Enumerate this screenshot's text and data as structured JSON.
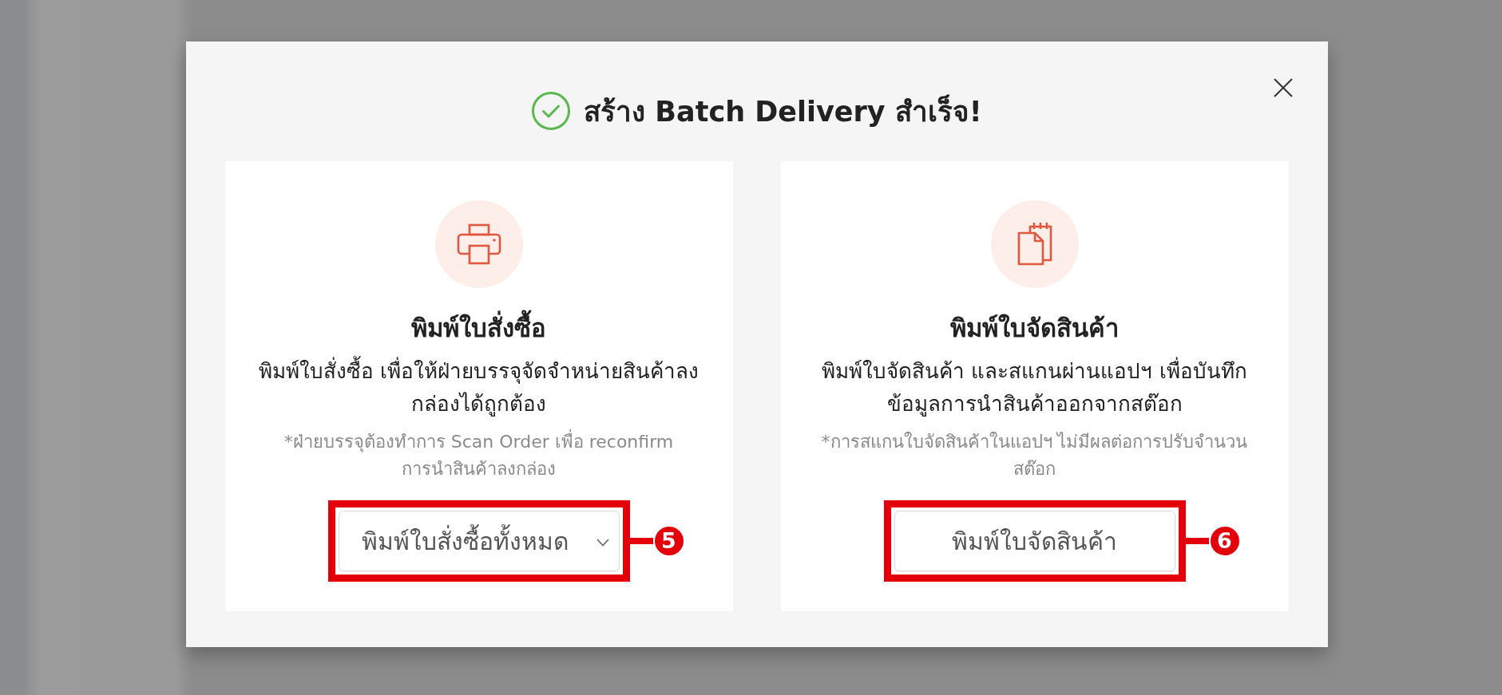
{
  "dialog": {
    "succeeded": true,
    "title": "สร้าง Batch Delivery สำเร็จ!"
  },
  "cards": [
    {
      "kind": "order",
      "title": "พิมพ์ใบสั่งซื้อ",
      "description": "พิมพ์ใบสั่งซื้อ เพื่อให้ฝ่ายบรรจุจัดจำหน่ายสินค้าลง\nกล่องได้ถูกต้อง",
      "note": "*ฝ่ายบรรจุต้องทำการ Scan Order เพื่อ reconfirm\nการนำสินค้าลงกล่อง",
      "action": {
        "kind": "dropdown",
        "label": "พิมพ์ใบสั่งซื้อทั้งหมด"
      },
      "callout": "5"
    },
    {
      "kind": "picking",
      "title": "พิมพ์ใบจัดสินค้า",
      "description": "พิมพ์ใบจัดสินค้า และสแกนผ่านแอปฯ เพื่อบันทึก\nข้อมูลการนำสินค้าออกจากสต๊อก",
      "note": "*การสแกนใบจัดสินค้าในแอปฯ ไม่มีผลต่อการปรับจำนวน\nสต๊อก",
      "action": {
        "kind": "button",
        "label": "พิมพ์ใบจัดสินค้า"
      },
      "callout": "6"
    }
  ]
}
